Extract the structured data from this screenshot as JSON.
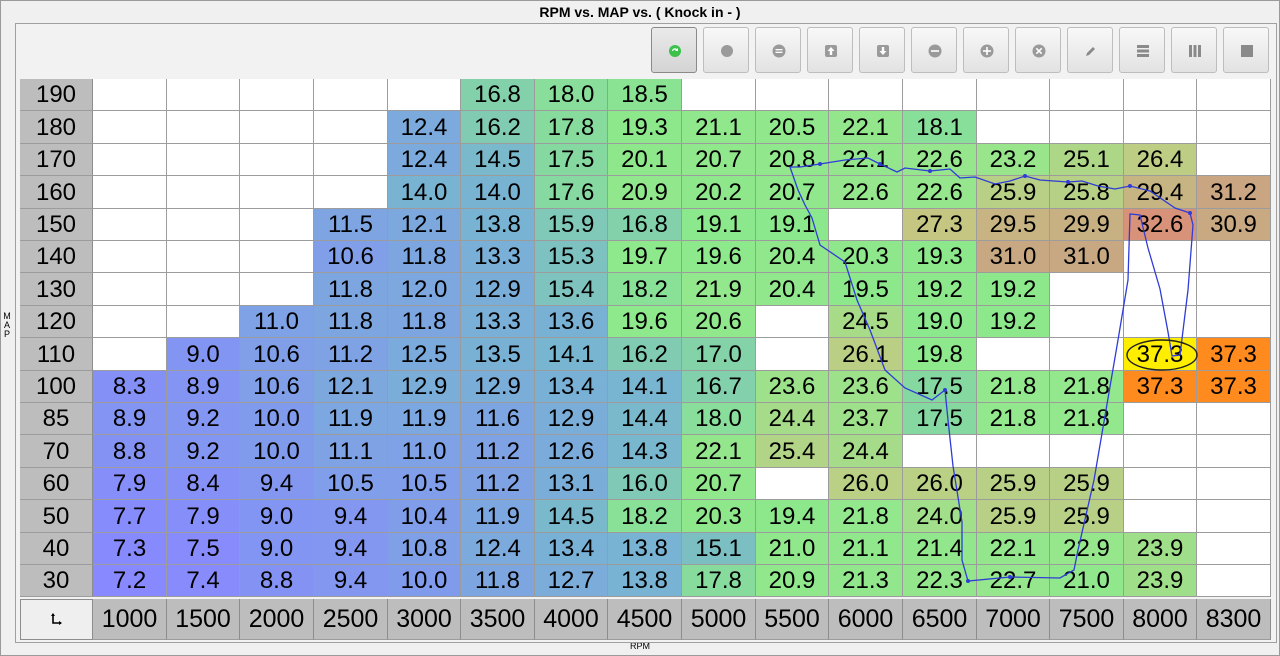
{
  "window": {
    "title": "RPM vs. MAP vs. ( Knock in -   )"
  },
  "axes": {
    "y_label": "MAP",
    "x_label": "RPM",
    "corner_icon": "swap-axes-icon"
  },
  "toolbar": {
    "buttons": [
      {
        "name": "refresh-button",
        "icon": "refresh-icon",
        "active": true
      },
      {
        "name": "record-button",
        "icon": "circle-icon"
      },
      {
        "name": "equal-button",
        "icon": "equal-icon"
      },
      {
        "name": "increase-button",
        "icon": "arrow-up-icon"
      },
      {
        "name": "decrease-button",
        "icon": "arrow-down-icon"
      },
      {
        "name": "subtract-button",
        "icon": "minus-icon"
      },
      {
        "name": "add-button",
        "icon": "plus-icon"
      },
      {
        "name": "clear-button",
        "icon": "close-icon"
      },
      {
        "name": "edit-button",
        "icon": "pencil-icon"
      },
      {
        "name": "rows-view-button",
        "icon": "rows-icon"
      },
      {
        "name": "columns-view-button",
        "icon": "columns-icon"
      },
      {
        "name": "full-view-button",
        "icon": "square-icon"
      }
    ]
  },
  "colors": {
    "low": "#8888ff",
    "mid": "#8ce88c",
    "high": "#c8a682",
    "hot": "#ff8a1e",
    "selected": "#ffee00",
    "trace": "#2f3cd6"
  },
  "table": {
    "rpm": [
      "1000",
      "1500",
      "2000",
      "2500",
      "3000",
      "3500",
      "4000",
      "4500",
      "5000",
      "5500",
      "6000",
      "6500",
      "7000",
      "7500",
      "8000",
      "8300"
    ],
    "map": [
      "190",
      "180",
      "170",
      "160",
      "150",
      "140",
      "130",
      "120",
      "110",
      "100",
      "85",
      "70",
      "60",
      "50",
      "40",
      "30"
    ],
    "values": [
      [
        "",
        "",
        "",
        "",
        "",
        "16.8",
        "18.0",
        "18.5",
        "",
        "",
        "",
        "",
        "",
        "",
        "",
        ""
      ],
      [
        "",
        "",
        "",
        "",
        "12.4",
        "16.2",
        "17.8",
        "19.3",
        "21.1",
        "20.5",
        "22.1",
        "18.1",
        "",
        "",
        "",
        ""
      ],
      [
        "",
        "",
        "",
        "",
        "12.4",
        "14.5",
        "17.5",
        "20.1",
        "20.7",
        "20.8",
        "22.1",
        "22.6",
        "23.2",
        "25.1",
        "26.4",
        ""
      ],
      [
        "",
        "",
        "",
        "",
        "14.0",
        "14.0",
        "17.6",
        "20.9",
        "20.2",
        "20.7",
        "22.6",
        "22.6",
        "25.9",
        "25.8",
        "29.4",
        "31.2"
      ],
      [
        "",
        "",
        "",
        "11.5",
        "12.1",
        "13.8",
        "15.9",
        "16.8",
        "19.1",
        "19.1",
        "",
        "27.3",
        "29.5",
        "29.9",
        "32.6",
        "30.9"
      ],
      [
        "",
        "",
        "",
        "10.6",
        "11.8",
        "13.3",
        "15.3",
        "19.7",
        "19.6",
        "20.4",
        "20.3",
        "19.3",
        "31.0",
        "31.0",
        "",
        ""
      ],
      [
        "",
        "",
        "",
        "11.8",
        "12.0",
        "12.9",
        "15.4",
        "18.2",
        "21.9",
        "20.4",
        "19.5",
        "19.2",
        "19.2",
        "",
        "",
        ""
      ],
      [
        "",
        "",
        "11.0",
        "11.8",
        "11.8",
        "13.3",
        "13.6",
        "19.6",
        "20.6",
        "",
        "24.5",
        "19.0",
        "19.2",
        "",
        "",
        ""
      ],
      [
        "",
        "9.0",
        "10.6",
        "11.2",
        "12.5",
        "13.5",
        "14.1",
        "16.2",
        "17.0",
        "",
        "26.1",
        "19.8",
        "",
        "",
        "37.3",
        "37.3"
      ],
      [
        "8.3",
        "8.9",
        "10.6",
        "12.1",
        "12.9",
        "12.9",
        "13.4",
        "14.1",
        "16.7",
        "23.6",
        "23.6",
        "17.5",
        "21.8",
        "21.8",
        "37.3",
        "37.3"
      ],
      [
        "8.9",
        "9.2",
        "10.0",
        "11.9",
        "11.9",
        "11.6",
        "12.9",
        "14.4",
        "18.0",
        "24.4",
        "23.7",
        "17.5",
        "21.8",
        "21.8",
        "",
        ""
      ],
      [
        "8.8",
        "9.2",
        "10.0",
        "11.1",
        "11.0",
        "11.2",
        "12.6",
        "14.3",
        "22.1",
        "25.4",
        "24.4",
        "",
        "",
        "",
        "",
        ""
      ],
      [
        "7.9",
        "8.4",
        "9.4",
        "10.5",
        "10.5",
        "11.2",
        "13.1",
        "16.0",
        "20.7",
        "",
        "26.0",
        "26.0",
        "25.9",
        "25.9",
        "",
        ""
      ],
      [
        "7.7",
        "7.9",
        "9.0",
        "9.4",
        "10.4",
        "11.9",
        "14.5",
        "18.2",
        "20.3",
        "19.4",
        "21.8",
        "24.0",
        "25.9",
        "25.9",
        "",
        ""
      ],
      [
        "7.3",
        "7.5",
        "9.0",
        "9.4",
        "10.8",
        "12.4",
        "13.4",
        "13.8",
        "15.1",
        "21.0",
        "21.1",
        "21.4",
        "22.1",
        "22.9",
        "23.9",
        ""
      ],
      [
        "7.2",
        "7.4",
        "8.8",
        "9.4",
        "10.0",
        "11.8",
        "12.7",
        "13.8",
        "17.8",
        "20.9",
        "21.3",
        "22.3",
        "22.7",
        "21.0",
        "23.9",
        ""
      ]
    ],
    "selected_cell": {
      "row": 8,
      "col": 14
    },
    "hot_cells": [
      {
        "row": 8,
        "col": 15
      },
      {
        "row": 9,
        "col": 14
      },
      {
        "row": 9,
        "col": 15
      }
    ]
  }
}
